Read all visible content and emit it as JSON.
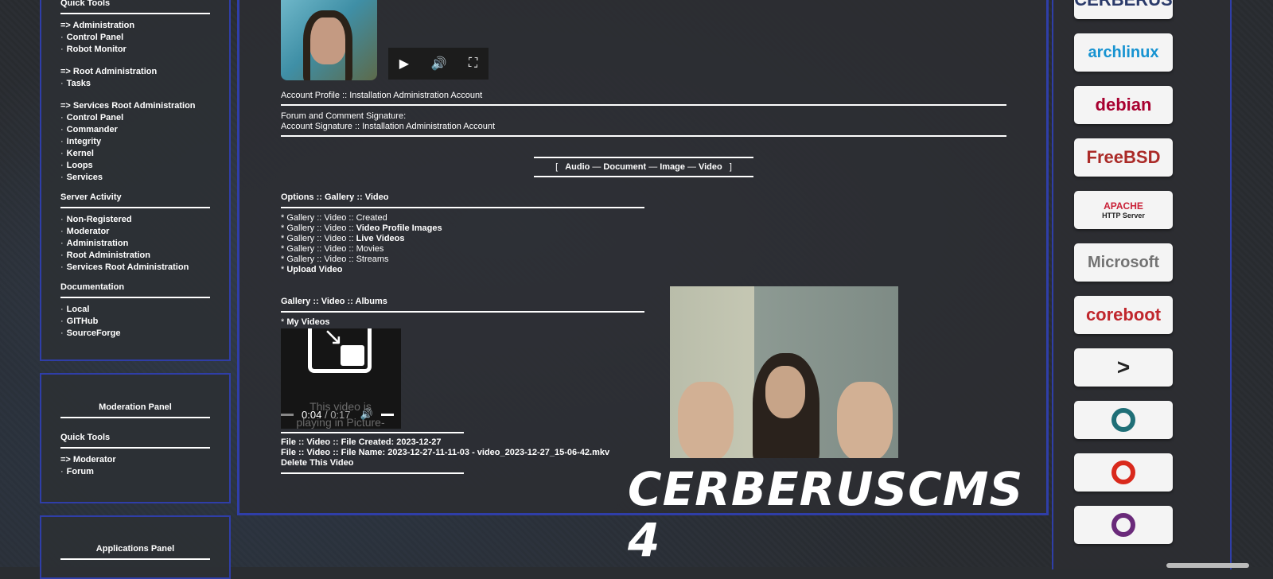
{
  "left_panel1": {
    "quick_tools": "Quick Tools",
    "groups": [
      {
        "header": "=> Administration",
        "items": [
          "Control Panel",
          "Robot Monitor"
        ]
      },
      {
        "header": "=> Root Administration",
        "items": [
          "Tasks"
        ]
      },
      {
        "header": "=> Services Root Administration",
        "items": [
          "Control Panel",
          "Commander",
          "Integrity",
          "Kernel",
          "Loops",
          "Services"
        ]
      }
    ],
    "server_activity": {
      "title": "Server Activity",
      "items": [
        "Non-Registered",
        "Moderator",
        "Administration",
        "Root Administration",
        "Services Root Administration"
      ]
    },
    "documentation": {
      "title": "Documentation",
      "items": [
        "Local",
        "GITHub",
        "SourceForge"
      ]
    }
  },
  "moderation_panel": {
    "title": "Moderation Panel",
    "quick_tools": "Quick Tools",
    "header": "=> Moderator",
    "items": [
      "Forum"
    ]
  },
  "applications_panel": {
    "title": "Applications Panel"
  },
  "main": {
    "profile_line": "Account Profile :: Installation Administration Account",
    "signature_title": "Forum and Comment Signature:",
    "signature_line": "Account Signature :: Installation Administration Account",
    "media_nav": {
      "open": "[",
      "close": "]",
      "sep": "—",
      "links": [
        "Audio",
        "Document",
        "Image",
        "Video"
      ]
    },
    "options_title": "Options :: Gallery :: Video",
    "options": [
      {
        "prefix": "* Gallery :: Video :: ",
        "label": "Created",
        "bold": false
      },
      {
        "prefix": "* Gallery :: Video :: ",
        "label": "Video Profile Images",
        "bold": true
      },
      {
        "prefix": "* Gallery :: Video :: ",
        "label": "Live Videos",
        "bold": true
      },
      {
        "prefix": "* Gallery :: Video :: ",
        "label": "Movies",
        "bold": false
      },
      {
        "prefix": "* Gallery :: Video :: ",
        "label": "Streams",
        "bold": false
      },
      {
        "prefix": "* ",
        "label": "Upload Video",
        "bold": true
      }
    ],
    "albums_title": "Gallery :: Video :: Albums",
    "my_videos_prefix": "* ",
    "my_videos": "My Videos",
    "player": {
      "pip_text": "This video is playing in Picture-",
      "time": "0:04",
      "duration": "0:17",
      "sep": "/",
      "progress": 0.235
    },
    "file_created": "File :: Video :: File Created: 2023-12-27",
    "file_name": "File :: Video :: File Name: 2023-12-27-11-11-03 - video_2023-12-27_15-06-42.mkv",
    "delete": "Delete This Video",
    "brand": "CERBERUSCMS 4"
  },
  "right_logos": [
    {
      "name": "CERBERUS",
      "color": "#2a3a6a"
    },
    {
      "name": "archlinux",
      "color": "#1793d1"
    },
    {
      "name": "debian",
      "color": "#a80030"
    },
    {
      "name": "FreeBSD",
      "color": "#ab2b28"
    },
    {
      "name": "APACHE",
      "sub": "HTTP Server",
      "color": "#c92037"
    },
    {
      "name": "Microsoft",
      "color": "#737373"
    },
    {
      "name": "coreboot",
      "color": "#c0272d"
    },
    {
      "name": ">",
      "color": "#222222"
    },
    {
      "name": "",
      "color": "#1f6f77"
    },
    {
      "name": "",
      "color": "#d9291c"
    },
    {
      "name": "",
      "color": "#6a2a7a"
    }
  ]
}
